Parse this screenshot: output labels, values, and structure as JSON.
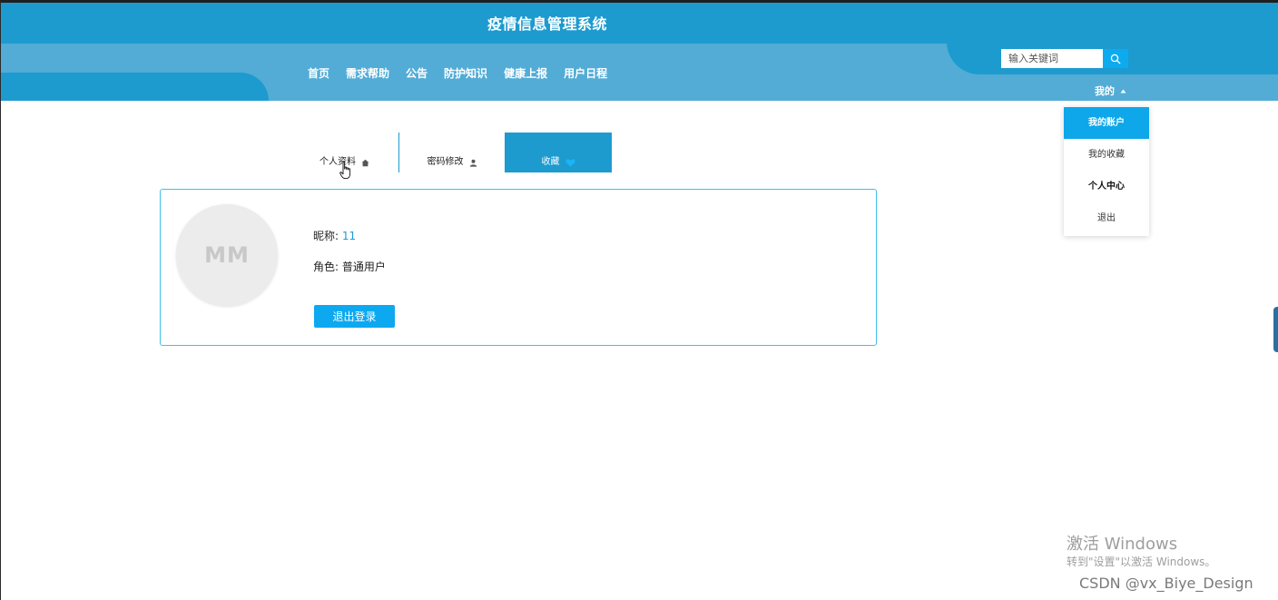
{
  "header": {
    "site_title": "疫情信息管理系统",
    "nav": [
      {
        "label": "首页"
      },
      {
        "label": "需求帮助"
      },
      {
        "label": "公告"
      },
      {
        "label": "防护知识"
      },
      {
        "label": "健康上报"
      },
      {
        "label": "用户日程"
      }
    ],
    "search": {
      "placeholder": "输入关键词",
      "icon": "search-icon"
    },
    "my_menu": {
      "label": "我的",
      "icon": "caret-up-icon"
    }
  },
  "dropdown": {
    "items": [
      {
        "label": "我的账户",
        "active": true
      },
      {
        "label": "我的收藏"
      },
      {
        "label": "个人中心"
      },
      {
        "label": "退出"
      }
    ]
  },
  "tabs": [
    {
      "label": "个人资料",
      "icon": "home-icon"
    },
    {
      "label": "密码修改",
      "icon": "user-icon"
    },
    {
      "label": "收藏",
      "icon": "heart-icon",
      "active": true
    }
  ],
  "profile": {
    "avatar_text": "MM",
    "nickname_label": "昵称:",
    "nickname_value": "11",
    "role_label": "角色:",
    "role_value": "普通用户",
    "logout_label": "退出登录"
  },
  "overlay": {
    "activate_title": "激活 Windows",
    "activate_sub": "转到\"设置\"以激活 Windows。",
    "watermark": "CSDN @vx_Biye_Design"
  },
  "colors": {
    "header_dark": "#1d9bcf",
    "header_light": "#52acd6",
    "accent": "#0ca9f0",
    "nickname": "#1b9ad6",
    "card_border": "#3fc1e8"
  }
}
